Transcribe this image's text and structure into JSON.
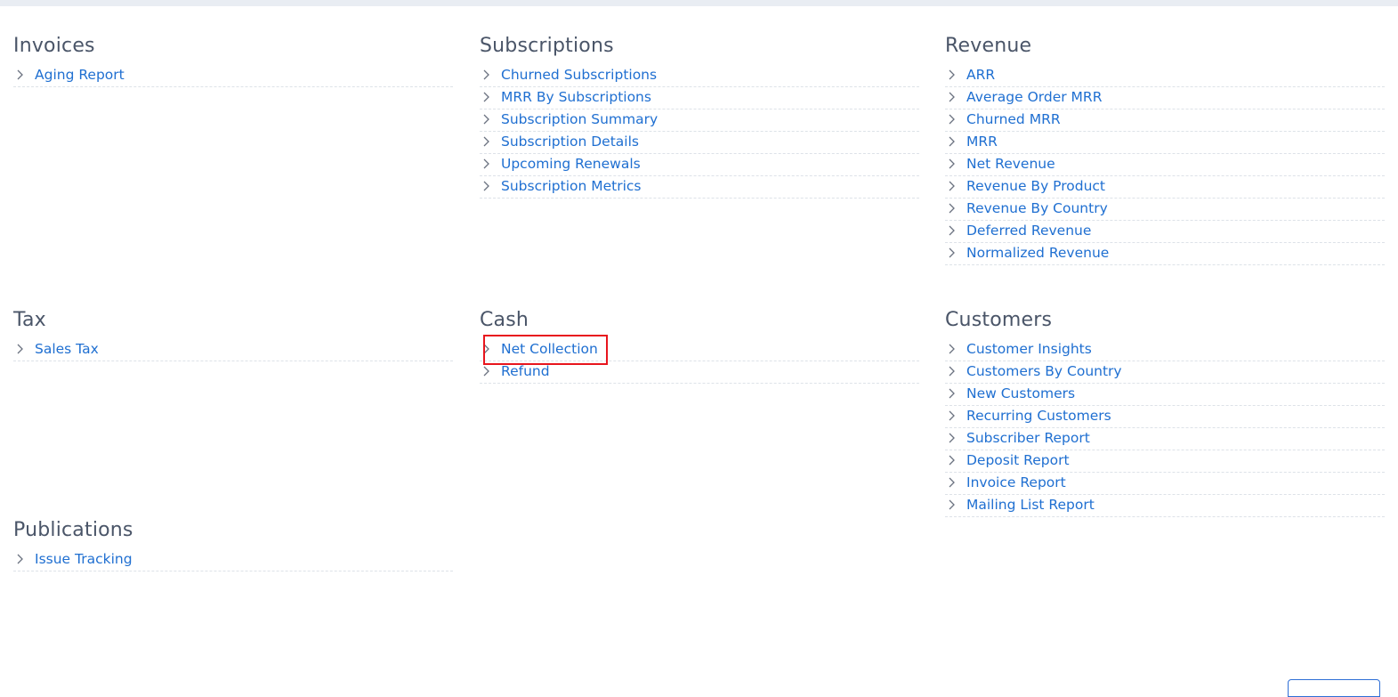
{
  "sections": {
    "invoices": {
      "title": "Invoices",
      "items": [
        {
          "label": "Aging Report"
        }
      ]
    },
    "subscriptions": {
      "title": "Subscriptions",
      "items": [
        {
          "label": "Churned Subscriptions"
        },
        {
          "label": "MRR By Subscriptions"
        },
        {
          "label": "Subscription Summary"
        },
        {
          "label": "Subscription Details"
        },
        {
          "label": "Upcoming Renewals"
        },
        {
          "label": "Subscription Metrics"
        }
      ]
    },
    "revenue": {
      "title": "Revenue",
      "items": [
        {
          "label": "ARR"
        },
        {
          "label": "Average Order MRR"
        },
        {
          "label": "Churned MRR"
        },
        {
          "label": "MRR"
        },
        {
          "label": "Net Revenue"
        },
        {
          "label": "Revenue By Product"
        },
        {
          "label": "Revenue By Country"
        },
        {
          "label": "Deferred Revenue"
        },
        {
          "label": "Normalized Revenue"
        }
      ]
    },
    "tax": {
      "title": "Tax",
      "items": [
        {
          "label": "Sales Tax"
        }
      ]
    },
    "cash": {
      "title": "Cash",
      "items": [
        {
          "label": "Net Collection"
        },
        {
          "label": "Refund"
        }
      ]
    },
    "customers": {
      "title": "Customers",
      "items": [
        {
          "label": "Customer Insights"
        },
        {
          "label": "Customers By Country"
        },
        {
          "label": "New Customers"
        },
        {
          "label": "Recurring Customers"
        },
        {
          "label": "Subscriber Report"
        },
        {
          "label": "Deposit Report"
        },
        {
          "label": "Invoice Report"
        },
        {
          "label": "Mailing List Report"
        }
      ]
    },
    "publications": {
      "title": "Publications",
      "items": [
        {
          "label": "Issue Tracking"
        }
      ]
    }
  },
  "icons": {
    "item_icon": "chevron-right-icon"
  },
  "colors": {
    "link": "#1f6fd1",
    "heading": "#4a5568",
    "divider": "#dde2e8",
    "highlight": "#e8151d"
  }
}
